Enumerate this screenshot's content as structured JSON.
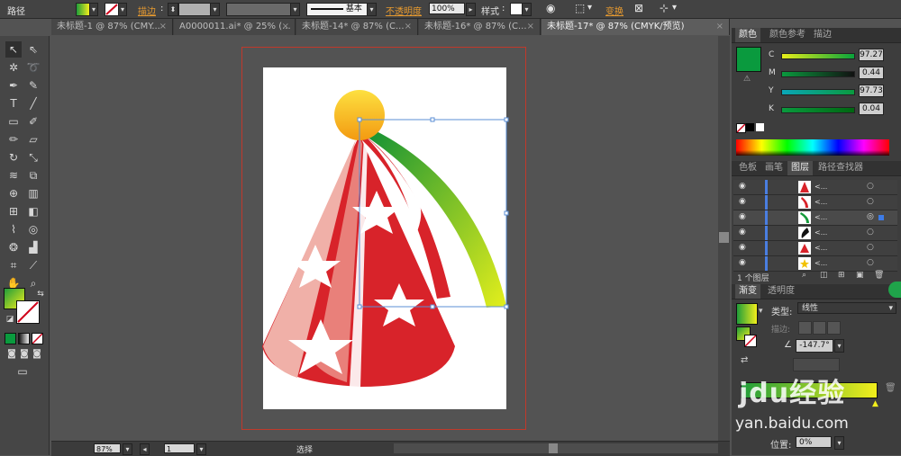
{
  "control_bar": {
    "object_label": "路径",
    "stroke_label": "描边",
    "stroke_style_label": "基本",
    "opacity_label": "不透明度",
    "opacity_value": "100%",
    "style_label": "样式",
    "transform_label": "变换"
  },
  "tabs": [
    {
      "label": "未标题-1 @ 87% (CMY..."
    },
    {
      "label": "A0000011.ai* @ 25% (..."
    },
    {
      "label": "未标题-14* @ 87% (C..."
    },
    {
      "label": "未标题-16* @ 87% (C..."
    },
    {
      "label": "未标题-17* @ 87% (CMYK/预览)"
    }
  ],
  "tab_close": "×",
  "color_panel": {
    "tabs": [
      "颜色",
      "颜色参考",
      "描边"
    ],
    "channels": [
      {
        "label": "C",
        "value": "97.27"
      },
      {
        "label": "M",
        "value": "0.44"
      },
      {
        "label": "Y",
        "value": "97.73"
      },
      {
        "label": "K",
        "value": "0.04"
      }
    ],
    "fill_color": "#0a9a3e"
  },
  "layers_panel": {
    "tabs": [
      "色板",
      "画笔",
      "图层",
      "路径查找器"
    ],
    "footer": "1 个图层",
    "rows": [
      {
        "name": "<..."
      },
      {
        "name": "<..."
      },
      {
        "name": "<..."
      },
      {
        "name": "<..."
      },
      {
        "name": "<..."
      },
      {
        "name": "<..."
      }
    ]
  },
  "gradient_panel": {
    "tabs": [
      "渐变",
      "透明度"
    ],
    "type_label": "类型:",
    "type_value": "线性",
    "stroke_label": "描边:",
    "angle_value": "-147.7°",
    "position_label": "位置:",
    "position_value": "0%",
    "start_color": "#1f9d3a",
    "end_color": "#f2ee1c"
  },
  "status_bar": {
    "zoom": "87%",
    "page": "1",
    "tool_label": "选择"
  },
  "watermark": {
    "brand": "jdu经验",
    "url": "yan.baidu.com"
  }
}
